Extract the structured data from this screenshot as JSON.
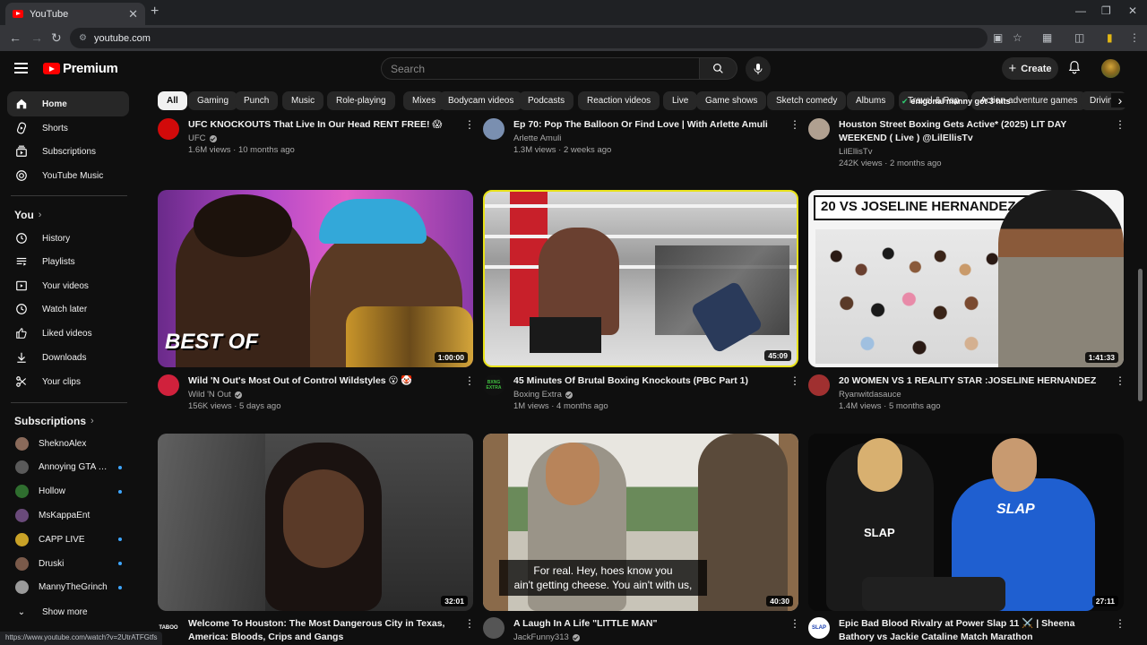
{
  "browser": {
    "tab_title": "YouTube",
    "tab_close": "✕",
    "new_tab": "+",
    "url": "youtube.com",
    "status_url": "https://www.youtube.com/watch?v=2UtrATFGtfs"
  },
  "header": {
    "logo_text": "Premium",
    "search_placeholder": "Search",
    "create_label": "Create"
  },
  "sidebar": {
    "main": [
      {
        "label": "Home",
        "icon": "home-icon"
      },
      {
        "label": "Shorts",
        "icon": "shorts-icon"
      },
      {
        "label": "Subscriptions",
        "icon": "subscriptions-icon"
      },
      {
        "label": "YouTube Music",
        "icon": "music-icon"
      }
    ],
    "you_heading": "You",
    "you_items": [
      {
        "label": "History",
        "icon": "history-icon"
      },
      {
        "label": "Playlists",
        "icon": "playlists-icon"
      },
      {
        "label": "Your videos",
        "icon": "your-videos-icon"
      },
      {
        "label": "Watch later",
        "icon": "watch-later-icon"
      },
      {
        "label": "Liked videos",
        "icon": "thumbs-up-icon"
      },
      {
        "label": "Downloads",
        "icon": "download-icon"
      },
      {
        "label": "Your clips",
        "icon": "scissors-icon"
      }
    ],
    "subs_heading": "Subscriptions",
    "subscriptions": [
      {
        "name": "SheknoAlex",
        "live": false,
        "color": "#8a6a5a"
      },
      {
        "name": "Annoying GTA Li...",
        "live": true,
        "color": "#5a5a5a"
      },
      {
        "name": "Hollow",
        "live": true,
        "color": "#2f6e2f"
      },
      {
        "name": "MsKappaEnt",
        "live": false,
        "color": "#6a4a7a"
      },
      {
        "name": "CAPP LIVE",
        "live": true,
        "color": "#c9a227"
      },
      {
        "name": "Druski",
        "live": true,
        "color": "#7a5a4a"
      },
      {
        "name": "MannyTheGrinch",
        "live": true,
        "color": "#9a9a9a"
      }
    ],
    "show_more": "Show more"
  },
  "chips": [
    "All",
    "Gaming",
    "Punch",
    "Music",
    "Role-playing",
    "Mixes",
    "Bodycam videos",
    "Podcasts",
    "Reaction videos",
    "Live",
    "Game shows",
    "Sketch comedy",
    "Albums",
    "Travel & Pop",
    "Action-adventure games",
    "Driving"
  ],
  "chip_overlay": "enigonal manny got 3 hits",
  "videos_top": [
    {
      "title": "UFC KNOCKOUTS That Live In Our Head RENT FREE! 😱",
      "channel": "UFC",
      "verified": true,
      "stats": "1.6M views · 10 months ago",
      "avatar_color": "#d20a0a"
    },
    {
      "title": "Ep 70: Pop The Balloon Or Find Love | With Arlette Amuli",
      "channel": "Arlette Amuli",
      "verified": false,
      "stats": "1.3M views · 2 weeks ago",
      "avatar_color": "#7a8fb0"
    },
    {
      "title": "Houston Street Boxing Gets Active* (2025) LIT DAY WEEKEND ( Live ) @LilEllisTv",
      "channel": "LilEllisTv",
      "verified": false,
      "stats": "242K views · 2 months ago",
      "avatar_color": "#b0a090"
    }
  ],
  "videos_mid": [
    {
      "title": "Wild 'N Out's Most Out of Control Wildstyles 😮 🤡",
      "channel": "Wild 'N Out",
      "verified": true,
      "stats": "156K views · 5 days ago",
      "duration": "1:00:00",
      "thumb_text": "BEST OF",
      "avatar_color": "#d0213c"
    },
    {
      "title": "45 Minutes Of Brutal Boxing Knockouts (PBC Part 1)",
      "channel": "Boxing Extra",
      "verified": true,
      "stats": "1M views · 4 months ago",
      "duration": "45:09",
      "avatar_text": "BXNG EXTRA",
      "avatar_color": "#111111"
    },
    {
      "title": "20 WOMEN VS 1 REALITY STAR :JOSELINE HERNANDEZ",
      "channel": "Ryanwitdasauce",
      "verified": false,
      "stats": "1.4M views · 5 months ago",
      "duration": "1:41:33",
      "thumb_text": "20 VS JOSELINE HERNANDEZ",
      "avatar_color": "#a03030"
    }
  ],
  "videos_bottom": [
    {
      "title": "Welcome To Houston: The Most Dangerous City in Texas, America: Bloods, Crips and Gangs",
      "channel": "",
      "duration": "32:01",
      "avatar_text": "TABOO"
    },
    {
      "title": "A Laugh In A Life \"LITTLE MAN\"",
      "channel": "JackFunny313",
      "verified": true,
      "duration": "40:30",
      "caption_line1": "For real. Hey, hoes know you",
      "caption_line2": "ain't getting cheese. You ain't with us,",
      "avatar_color": "#555555"
    },
    {
      "title": "Epic Bad Blood Rivalry at Power Slap 11 ⚔️ | Sheena Bathory vs Jackie Cataline Match Marathon",
      "channel": "",
      "duration": "27:11",
      "shirt_text_1": "SLAP",
      "shirt_text_2": "SLAP",
      "avatar_text": "SLAP",
      "avatar_color": "#1a3fb0"
    }
  ],
  "colors": {
    "background": "#0f0f0f",
    "chip": "#272727",
    "brand_red": "#ff0000",
    "secondary_text": "#aaaaaa"
  }
}
